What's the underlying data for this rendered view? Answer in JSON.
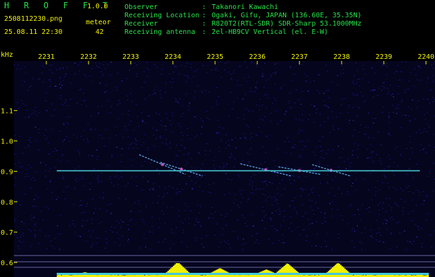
{
  "header": {
    "app_name": "H R O F F T",
    "version": "1.0.0",
    "filename": "2508112230.png",
    "datetime": "25.08.11 22:30",
    "detection_label": "meteor",
    "detection_count": "42",
    "fields": [
      {
        "label": "Observer",
        "sep": ":",
        "value": "Takanori Kawachi"
      },
      {
        "label": "Receiving Location",
        "sep": ":",
        "value": "Ogaki, Gifu, JAPAN (136.60E, 35.35N)"
      },
      {
        "label": "Receiver",
        "sep": ":",
        "value": "R820T2(RTL-SDR) SDR-Sharp 53.1000MHz"
      },
      {
        "label": "Receiving antenna",
        "sep": ":",
        "value": "2el-HB9CV Vertical (el. E-W)"
      }
    ]
  },
  "colors": {
    "background": "#000000",
    "header_text": "#27e04a",
    "axis_text": "#f0f000",
    "carrier_line": "#46c8d2",
    "signal_bar": "#f0f000",
    "noise_blue": "#1a1a8c"
  },
  "chart_data": {
    "type": "heatmap",
    "ylabel": "kHz",
    "x_ticks": [
      "2231",
      "2232",
      "2233",
      "2234",
      "2235",
      "2236",
      "2237",
      "2238",
      "2239",
      "2240"
    ],
    "y_ticks": [
      "1.1",
      "1.0",
      "0.9",
      "0.8",
      "0.7",
      "0.6"
    ],
    "ylim": [
      0.6,
      1.17
    ],
    "carrier_khz": 0.902,
    "meteor_echoes": [
      {
        "t_start_min": 2.2,
        "t_end_min": 3.3,
        "f_start_khz": 0.955,
        "f_end_khz": 0.89
      },
      {
        "t_start_min": 2.7,
        "t_end_min": 3.7,
        "f_start_khz": 0.93,
        "f_end_khz": 0.885
      },
      {
        "t_start_min": 4.6,
        "t_end_min": 5.8,
        "f_start_khz": 0.925,
        "f_end_khz": 0.885
      },
      {
        "t_start_min": 5.5,
        "t_end_min": 6.5,
        "f_start_khz": 0.915,
        "f_end_khz": 0.89
      },
      {
        "t_start_min": 6.3,
        "t_end_min": 7.2,
        "f_start_khz": 0.922,
        "f_end_khz": 0.885
      }
    ],
    "signal_strength_peaks": [
      {
        "t_min": 0.9,
        "level": 0.25
      },
      {
        "t_min": 3.1,
        "level": 1.0
      },
      {
        "t_min": 4.1,
        "level": 0.55
      },
      {
        "t_min": 5.2,
        "level": 0.45
      },
      {
        "t_min": 5.7,
        "level": 0.9
      },
      {
        "t_min": 6.9,
        "level": 0.95
      }
    ]
  }
}
